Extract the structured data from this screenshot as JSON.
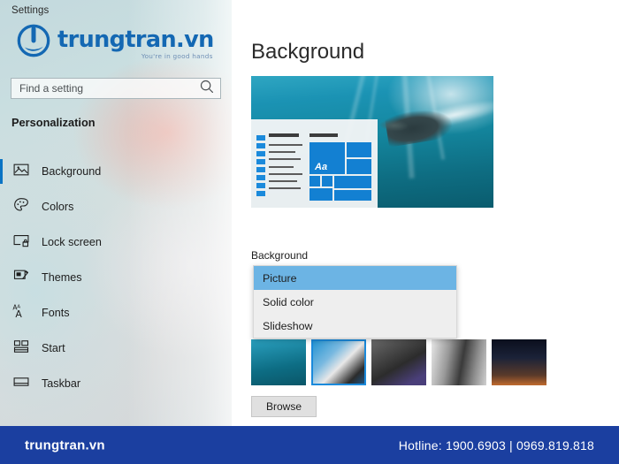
{
  "window": {
    "titlebar": "Settings"
  },
  "branding": {
    "logo_icon": "power-button-icon",
    "name": "trungtran.vn",
    "tagline": "You're in good hands",
    "brand_color": "#1468b3"
  },
  "search": {
    "placeholder": "Find a setting",
    "value": "",
    "icon": "search-icon"
  },
  "sidebar": {
    "section_title": "Personalization",
    "items": [
      {
        "label": "Background",
        "icon": "image-icon",
        "selected": true
      },
      {
        "label": "Colors",
        "icon": "palette-icon",
        "selected": false
      },
      {
        "label": "Lock screen",
        "icon": "lock-screen-icon",
        "selected": false
      },
      {
        "label": "Themes",
        "icon": "themes-icon",
        "selected": false
      },
      {
        "label": "Fonts",
        "icon": "fonts-icon",
        "selected": false
      },
      {
        "label": "Start",
        "icon": "start-tiles-icon",
        "selected": false
      },
      {
        "label": "Taskbar",
        "icon": "taskbar-icon",
        "selected": false
      }
    ],
    "accent_color": "#0a74c4"
  },
  "main": {
    "page_title": "Background",
    "preview_alt": "Desktop preview: underwater diver wallpaper with Start menu mockup",
    "preview_tile_text": "Aa",
    "field_label": "Background",
    "dropdown": {
      "selected": "Picture",
      "options": [
        {
          "label": "Picture",
          "active": true
        },
        {
          "label": "Solid color",
          "active": false
        },
        {
          "label": "Slideshow",
          "active": false
        }
      ],
      "highlight_color": "#6cb4e4"
    },
    "thumbnails": [
      {
        "name": "underwater-diver-thumbnail",
        "selected": false
      },
      {
        "name": "workbench-monitor-thumbnail",
        "selected": true
      },
      {
        "name": "motherboard-thumbnail",
        "selected": false
      },
      {
        "name": "rock-texture-thumbnail",
        "selected": false
      },
      {
        "name": "night-sky-thumbnail",
        "selected": false
      }
    ],
    "browse_button": "Browse"
  },
  "footer": {
    "brand": "trungtran.vn",
    "hotline": "Hotline: 1900.6903  |  0969.819.818",
    "background_color": "#1b3fa0"
  }
}
